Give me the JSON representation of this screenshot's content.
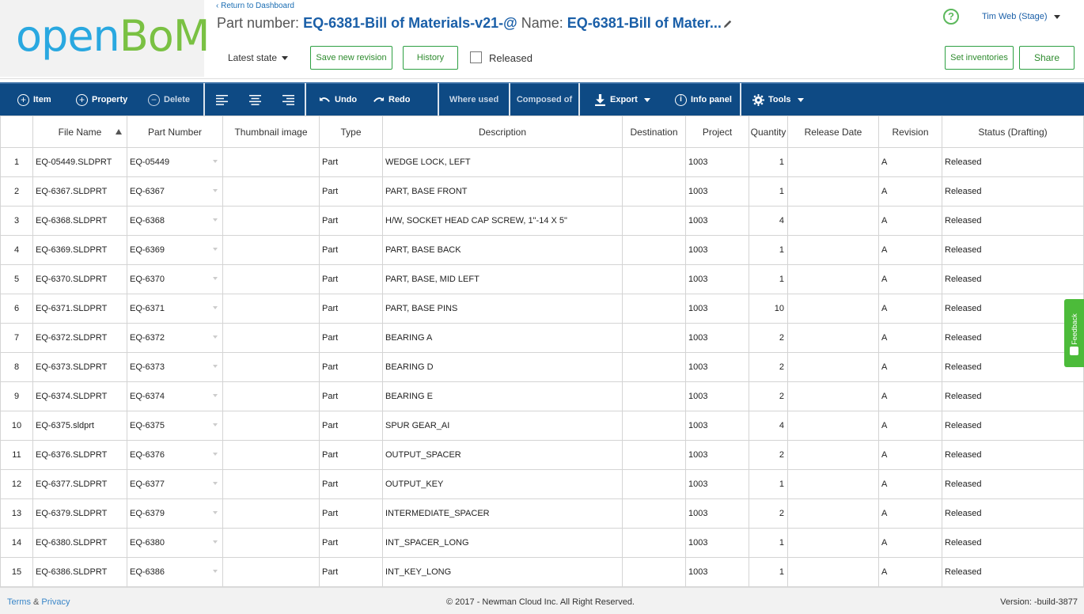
{
  "header": {
    "logo_part1": "open",
    "logo_part2": "BoM",
    "return_link": "Return to Dashboard",
    "part_number_label": "Part number:",
    "part_number_value": "EQ-6381-Bill of Materials-v21-@",
    "name_label": "Name:",
    "name_value": "EQ-6381-Bill of Mater...",
    "state_select": "Latest state",
    "save_revision_label": "Save new revision",
    "history_label": "History",
    "released_label": "Released",
    "released_checked": false,
    "user_name": "Tim Web (Stage)",
    "help_symbol": "?",
    "set_inventories_label": "Set inventories",
    "share_label": "Share"
  },
  "toolbar": {
    "item_label": "Item",
    "property_label": "Property",
    "delete_label": "Delete",
    "undo_label": "Undo",
    "redo_label": "Redo",
    "where_used_label": "Where used",
    "composed_of_label": "Composed of",
    "export_label": "Export",
    "info_panel_label": "Info panel",
    "tools_label": "Tools"
  },
  "table": {
    "columns": [
      "",
      "File Name",
      "Part Number",
      "Thumbnail image",
      "Type",
      "Description",
      "Destination",
      "Project",
      "Quantity",
      "Release Date",
      "Revision",
      "Status (Drafting)"
    ],
    "rows": [
      {
        "n": "1",
        "file": "EQ-05449.SLDPRT",
        "part": "EQ-05449",
        "thumb": "",
        "type": "Part",
        "desc": "WEDGE LOCK, LEFT",
        "dest": "",
        "project": "1003",
        "qty": "1",
        "rdate": "",
        "rev": "A",
        "status": "Released"
      },
      {
        "n": "2",
        "file": "EQ-6367.SLDPRT",
        "part": "EQ-6367",
        "thumb": "",
        "type": "Part",
        "desc": "PART, BASE FRONT",
        "dest": "",
        "project": "1003",
        "qty": "1",
        "rdate": "",
        "rev": "A",
        "status": "Released"
      },
      {
        "n": "3",
        "file": "EQ-6368.SLDPRT",
        "part": "EQ-6368",
        "thumb": "",
        "type": "Part",
        "desc": "H/W, SOCKET HEAD CAP SCREW, 1\"-14 X 5\"",
        "dest": "",
        "project": "1003",
        "qty": "4",
        "rdate": "",
        "rev": "A",
        "status": "Released"
      },
      {
        "n": "4",
        "file": "EQ-6369.SLDPRT",
        "part": "EQ-6369",
        "thumb": "",
        "type": "Part",
        "desc": "PART, BASE BACK",
        "dest": "",
        "project": "1003",
        "qty": "1",
        "rdate": "",
        "rev": "A",
        "status": "Released"
      },
      {
        "n": "5",
        "file": "EQ-6370.SLDPRT",
        "part": "EQ-6370",
        "thumb": "",
        "type": "Part",
        "desc": "PART, BASE, MID LEFT",
        "dest": "",
        "project": "1003",
        "qty": "1",
        "rdate": "",
        "rev": "A",
        "status": "Released"
      },
      {
        "n": "6",
        "file": "EQ-6371.SLDPRT",
        "part": "EQ-6371",
        "thumb": "",
        "type": "Part",
        "desc": "PART, BASE PINS",
        "dest": "",
        "project": "1003",
        "qty": "10",
        "rdate": "",
        "rev": "A",
        "status": "Released"
      },
      {
        "n": "7",
        "file": "EQ-6372.SLDPRT",
        "part": "EQ-6372",
        "thumb": "",
        "type": "Part",
        "desc": "BEARING A",
        "dest": "",
        "project": "1003",
        "qty": "2",
        "rdate": "",
        "rev": "A",
        "status": "Released"
      },
      {
        "n": "8",
        "file": "EQ-6373.SLDPRT",
        "part": "EQ-6373",
        "thumb": "",
        "type": "Part",
        "desc": "BEARING D",
        "dest": "",
        "project": "1003",
        "qty": "2",
        "rdate": "",
        "rev": "A",
        "status": "Released"
      },
      {
        "n": "9",
        "file": "EQ-6374.SLDPRT",
        "part": "EQ-6374",
        "thumb": "",
        "type": "Part",
        "desc": "BEARING E",
        "dest": "",
        "project": "1003",
        "qty": "2",
        "rdate": "",
        "rev": "A",
        "status": "Released"
      },
      {
        "n": "10",
        "file": "EQ-6375.sldprt",
        "part": "EQ-6375",
        "thumb": "",
        "type": "Part",
        "desc": "SPUR GEAR_AI",
        "dest": "",
        "project": "1003",
        "qty": "4",
        "rdate": "",
        "rev": "A",
        "status": "Released"
      },
      {
        "n": "11",
        "file": "EQ-6376.SLDPRT",
        "part": "EQ-6376",
        "thumb": "",
        "type": "Part",
        "desc": "OUTPUT_SPACER",
        "dest": "",
        "project": "1003",
        "qty": "2",
        "rdate": "",
        "rev": "A",
        "status": "Released"
      },
      {
        "n": "12",
        "file": "EQ-6377.SLDPRT",
        "part": "EQ-6377",
        "thumb": "",
        "type": "Part",
        "desc": "OUTPUT_KEY",
        "dest": "",
        "project": "1003",
        "qty": "1",
        "rdate": "",
        "rev": "A",
        "status": "Released"
      },
      {
        "n": "13",
        "file": "EQ-6379.SLDPRT",
        "part": "EQ-6379",
        "thumb": "",
        "type": "Part",
        "desc": "INTERMEDIATE_SPACER",
        "dest": "",
        "project": "1003",
        "qty": "2",
        "rdate": "",
        "rev": "A",
        "status": "Released"
      },
      {
        "n": "14",
        "file": "EQ-6380.SLDPRT",
        "part": "EQ-6380",
        "thumb": "",
        "type": "Part",
        "desc": "INT_SPACER_LONG",
        "dest": "",
        "project": "1003",
        "qty": "1",
        "rdate": "",
        "rev": "A",
        "status": "Released"
      },
      {
        "n": "15",
        "file": "EQ-6386.SLDPRT",
        "part": "EQ-6386",
        "thumb": "",
        "type": "Part",
        "desc": "INT_KEY_LONG",
        "dest": "",
        "project": "1003",
        "qty": "1",
        "rdate": "",
        "rev": "A",
        "status": "Released"
      }
    ]
  },
  "feedback": {
    "label": "Feedback"
  },
  "footer": {
    "terms": "Terms",
    "amp": "&",
    "privacy": "Privacy",
    "copyright": "© 2017 - Newman Cloud Inc. All Right Reserved.",
    "version": "Version: -build-3877"
  },
  "colors": {
    "brand_blue": "#29a8e0",
    "brand_green": "#7ac143",
    "toolbar_bg": "#0e4a84",
    "button_green": "#2ea043",
    "title_blue": "#1a5fa8"
  }
}
